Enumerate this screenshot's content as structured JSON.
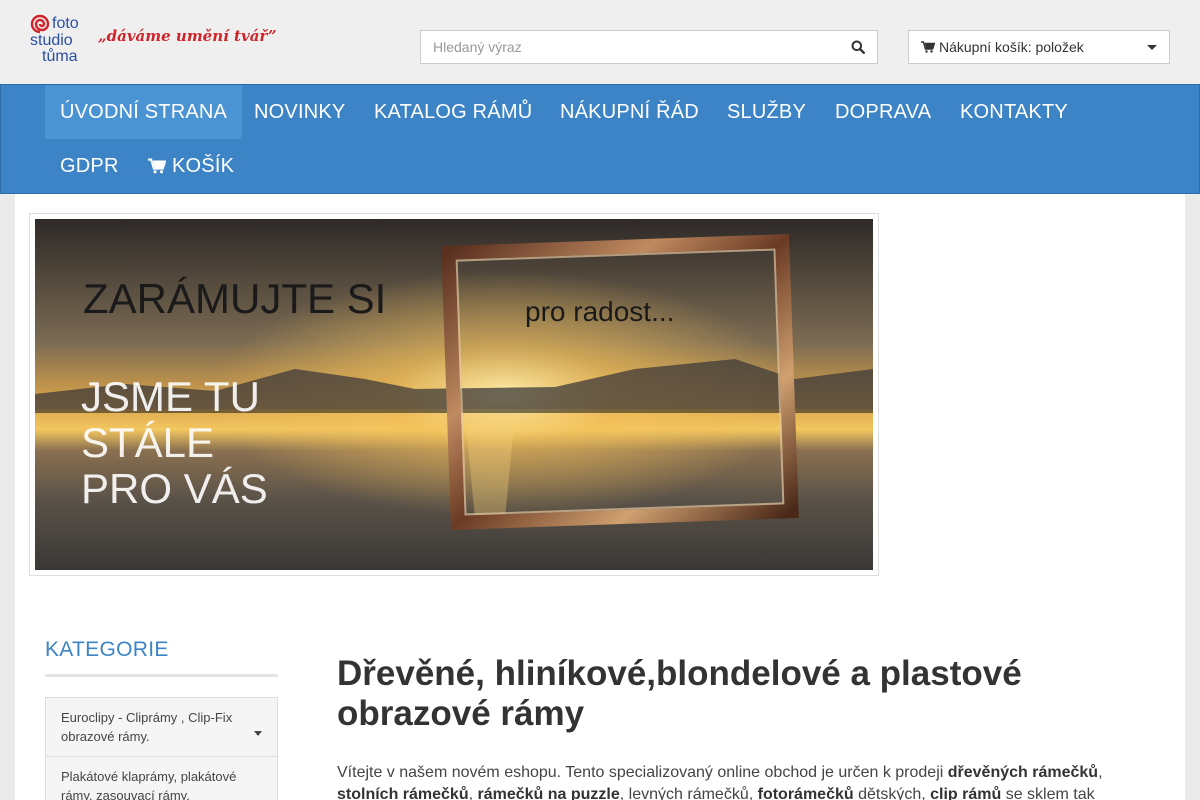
{
  "logo": {
    "line1": "foto",
    "line2": "studio",
    "line3": "tůma",
    "slogan": "„dáváme umění tvář”",
    "spiral_color": "#d0232a"
  },
  "search": {
    "placeholder": "Hledaný výraz",
    "value": "",
    "icon": "search-icon"
  },
  "cart": {
    "label": "Nákupní košík: položek",
    "icon": "shopping-cart-icon"
  },
  "nav": {
    "items": [
      {
        "label": "ÚVODNÍ STRANA",
        "active": true
      },
      {
        "label": "NOVINKY"
      },
      {
        "label": "KATALOG RÁMŮ"
      },
      {
        "label": "NÁKUPNÍ ŘÁD"
      },
      {
        "label": "SLUŽBY"
      },
      {
        "label": "DOPRAVA"
      },
      {
        "label": "KONTAKTY"
      },
      {
        "label": "GDPR"
      },
      {
        "label": "KOŠÍK",
        "icon": "shopping-cart-icon"
      }
    ],
    "color": "#3d84c6"
  },
  "banner": {
    "headline": "ZARÁMUJTE SI",
    "frame_text": "pro radost...",
    "line1": "JSME TU",
    "line2": "STÁLE",
    "line3": "PRO VÁS"
  },
  "sidebar": {
    "title": "KATEGORIE",
    "categories": [
      "Euroclipy - Cliprámy , Clip-Fix obrazové rámy.",
      "Plakátové klaprámy, plakátové rámy, zasouvací rámy, prezentace"
    ]
  },
  "content": {
    "title": "Dřevěné, hliníkové,blondelové a plastové obrazové rámy",
    "p_intro": "Vítejte v našem novém eshopu. Tento specializovaný online obchod je určen k  prodeji ",
    "b1": "dřevěných rámečků",
    "t1": ", ",
    "b2": "stolních rámečků",
    "t2": ", ",
    "b3": "rámečků na puzzle",
    "t3": ", levných rámečků, ",
    "b4": "fotorámečků",
    "t4": " dětských, ",
    "b5": "clip rámů",
    "t5": " se sklem tak"
  }
}
